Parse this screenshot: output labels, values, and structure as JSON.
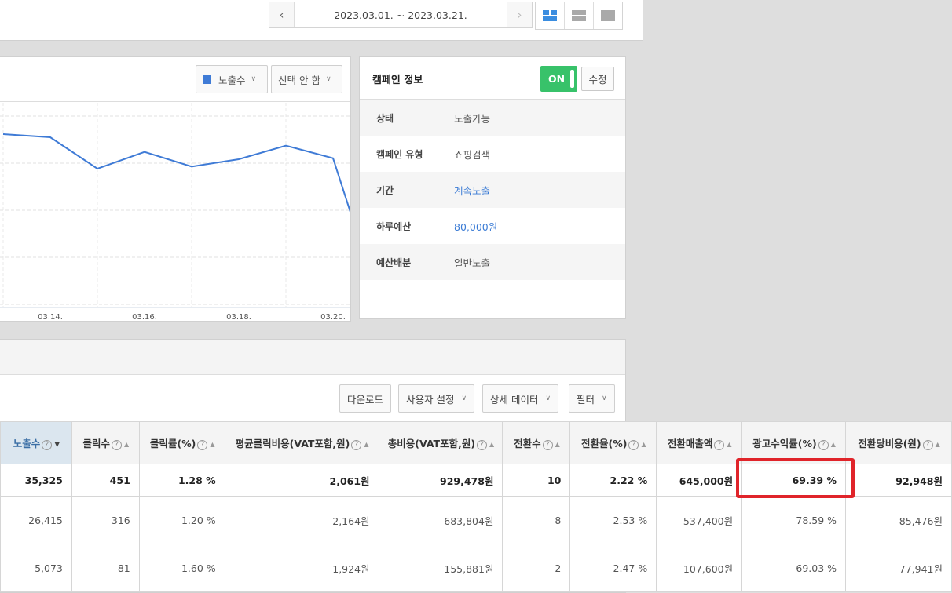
{
  "header": {
    "date_range": "2023.03.01. ~ 2023.03.21.",
    "prev_icon": "chevron-left-icon",
    "next_icon": "chevron-right-icon",
    "view_modes": [
      "grid-layout-icon",
      "rows-layout-icon",
      "single-layout-icon"
    ]
  },
  "chart_panel": {
    "metric_select": "노출수",
    "compare_select": "선택 안 함",
    "legend_color": "#3f7bd6"
  },
  "chart_data": {
    "type": "line",
    "x_tick_labels": [
      "03.14.",
      "03.16.",
      "03.18.",
      "03.20."
    ],
    "x": [
      "03.13.",
      "03.14.",
      "03.15.",
      "03.16.",
      "03.17.",
      "03.18.",
      "03.19.",
      "03.20.",
      "03.21."
    ],
    "series": [
      {
        "values": [
          1950,
          1920,
          1620,
          1780,
          1640,
          1710,
          1840,
          1720,
          320
        ]
      }
    ],
    "ylim": [
      300,
      2100
    ],
    "grid": true,
    "color": "#3f7bd6"
  },
  "campaign_info": {
    "title": "캠페인 정보",
    "status_toggle": "ON",
    "edit_label": "수정",
    "rows": [
      {
        "key": "상태",
        "value": "노출가능"
      },
      {
        "key": "캠페인 유형",
        "value": "쇼핑검색"
      },
      {
        "key": "기간",
        "value": "계속노출"
      },
      {
        "key": "하루예산",
        "value": "80,000원"
      },
      {
        "key": "예산배분",
        "value": "일반노출"
      }
    ]
  },
  "table_toolbar": {
    "download": "다운로드",
    "user_settings": "사용자 설정",
    "detail_data": "상세 데이터",
    "filter": "필터"
  },
  "table": {
    "columns": [
      "노출수",
      "클릭수",
      "클릭률(%)",
      "평균클릭비용(VAT포함,원)",
      "총비용(VAT포함,원)",
      "전환수",
      "전환율(%)",
      "전환매출액",
      "광고수익률(%)",
      "전환당비용(원)"
    ],
    "summary": [
      "35,325",
      "451",
      "1.28 %",
      "2,061원",
      "929,478원",
      "10",
      "2.22 %",
      "645,000원",
      "69.39 %",
      "92,948원"
    ],
    "rows": [
      [
        "26,415",
        "316",
        "1.20 %",
        "2,164원",
        "683,804원",
        "8",
        "2.53 %",
        "537,400원",
        "78.59 %",
        "85,476원"
      ],
      [
        "5,073",
        "81",
        "1.60 %",
        "1,924원",
        "155,881원",
        "2",
        "2.47 %",
        "107,600원",
        "69.03 %",
        "77,941원"
      ]
    ],
    "highlight_color": "#e0242a"
  }
}
